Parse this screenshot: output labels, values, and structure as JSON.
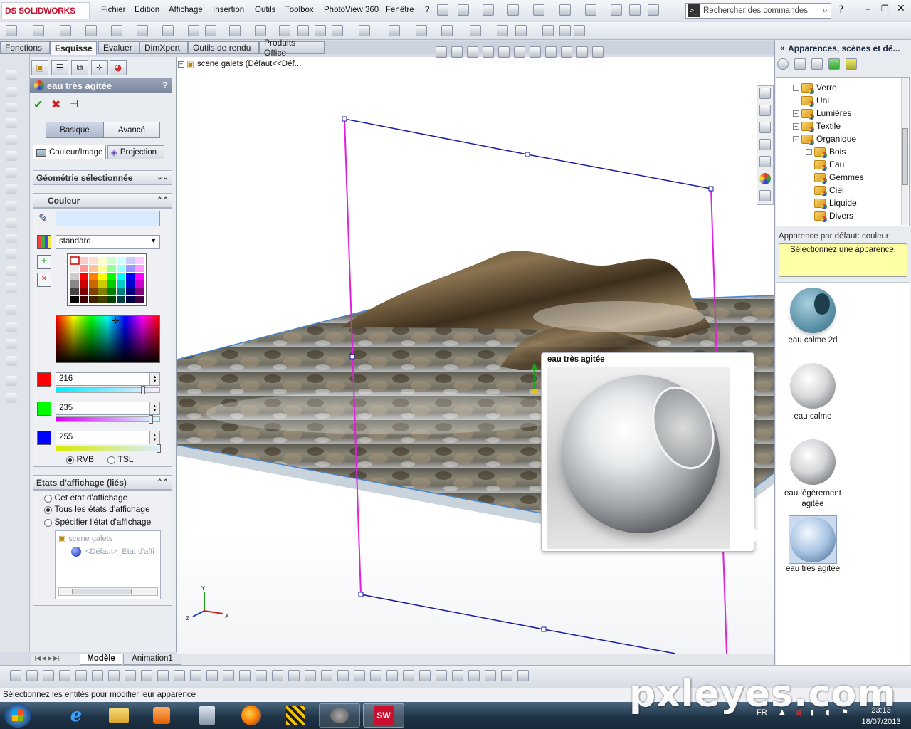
{
  "app": {
    "brand": "SOLIDWORKS",
    "brand_prefix": "DS"
  },
  "menu": [
    "Fichier",
    "Edition",
    "Affichage",
    "Insertion",
    "Outils",
    "Toolbox",
    "PhotoView 360",
    "Fenêtre",
    "?"
  ],
  "search": {
    "placeholder": "Rechercher des commandes"
  },
  "tabs": [
    "Fonctions",
    "Esquisse",
    "Evaluer",
    "DimXpert",
    "Outils de rendu",
    "Produits Office"
  ],
  "tabs_active": "Esquisse",
  "tree_header": "scene galets  (Défaut<<Déf...",
  "pm": {
    "title": "eau très agitée",
    "help": "?",
    "mode_basic": "Basique",
    "mode_advanced": "Avancé",
    "subtab_color": "Couleur/Image",
    "subtab_projection": "Projection",
    "section_geometry": "Géométrie sélectionnée",
    "section_color": "Couleur",
    "palette_select": "standard",
    "rgb": {
      "r": "216",
      "g": "235",
      "b": "255"
    },
    "mode_rvb": "RVB",
    "mode_tsl": "TSL",
    "section_display": "Etats d'affichage (liés)",
    "display_options": [
      "Cet état d'affichage",
      "Tous les états d'affichage",
      "Spécifier l'état d'affichage"
    ],
    "display_selected": 1,
    "display_list": [
      "scene galets",
      "<Défaut>_Etat d'affi"
    ]
  },
  "right_panel": {
    "title": "Apparences, scènes et dé...",
    "tree": [
      {
        "label": "Verre",
        "expander": "+"
      },
      {
        "label": "Uni",
        "expander": ""
      },
      {
        "label": "Lumières",
        "expander": "+"
      },
      {
        "label": "Textile",
        "expander": "+"
      },
      {
        "label": "Organique",
        "expander": "-"
      },
      {
        "label": "Bois",
        "expander": "+"
      },
      {
        "label": "Eau",
        "expander": ""
      },
      {
        "label": "Gemmes",
        "expander": ""
      },
      {
        "label": "Ciel",
        "expander": ""
      },
      {
        "label": "Liquide",
        "expander": ""
      },
      {
        "label": "Divers",
        "expander": ""
      }
    ],
    "default_label": "Apparence par défaut: couleur",
    "hint": "Sélectionnez une apparence.",
    "thumbnails": [
      "eau calme 2d",
      "eau calme",
      "eau légèrement agitée",
      "eau très agitée"
    ]
  },
  "tooltip": {
    "title": "eau très agitée"
  },
  "bottom_tabs": [
    "Modèle",
    "Animation1"
  ],
  "status": "Sélectionnez les entités pour modifier leur apparence",
  "taskbar": {
    "lang": "FR",
    "time": "23:13",
    "date": "18/07/2013"
  },
  "watermark": "pxleyes.com",
  "colors": {
    "red": "#ff0000",
    "green": "#00ff00",
    "blue": "#0000ff",
    "sketch_blue": "#1a1aa8",
    "sketch_magenta": "#e020e0"
  }
}
